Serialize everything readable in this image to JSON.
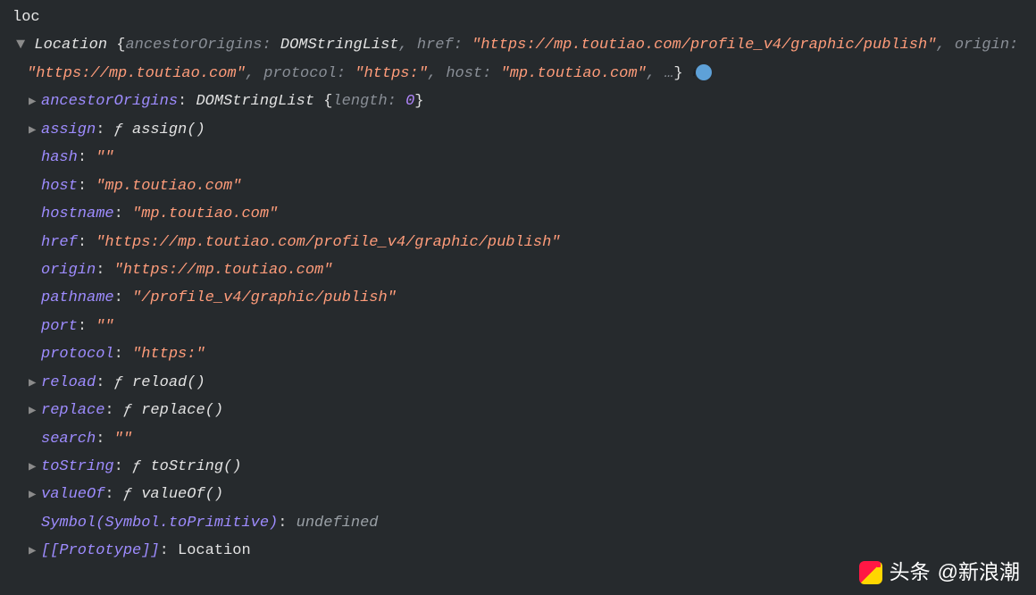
{
  "input": "loc",
  "summary": {
    "typeName": "Location",
    "pairs": [
      {
        "key": "ancestorOrigins",
        "val": "DOMStringList",
        "isStr": false
      },
      {
        "key": "href",
        "val": "\"https://mp.toutiao.com/profile_v4/graphic/publish\"",
        "isStr": true
      },
      {
        "key": "origin",
        "val": "\"https://mp.toutiao.com\"",
        "isStr": true
      },
      {
        "key": "protocol",
        "val": "\"https:\"",
        "isStr": true
      },
      {
        "key": "host",
        "val": "\"mp.toutiao.com\"",
        "isStr": true
      }
    ],
    "ellipsis": "…"
  },
  "props": [
    {
      "expand": true,
      "key": "ancestorOrigins",
      "rhsPrefix": "DOMStringList ",
      "rhsBraceL": "{",
      "innerKey": "length",
      "innerVal": "0",
      "rhsBraceR": "}"
    },
    {
      "expand": true,
      "key": "assign",
      "func": "assign()"
    },
    {
      "expand": false,
      "key": "hash",
      "str": "\"\""
    },
    {
      "expand": false,
      "key": "host",
      "str": "\"mp.toutiao.com\""
    },
    {
      "expand": false,
      "key": "hostname",
      "str": "\"mp.toutiao.com\""
    },
    {
      "expand": false,
      "key": "href",
      "str": "\"https://mp.toutiao.com/profile_v4/graphic/publish\""
    },
    {
      "expand": false,
      "key": "origin",
      "str": "\"https://mp.toutiao.com\""
    },
    {
      "expand": false,
      "key": "pathname",
      "str": "\"/profile_v4/graphic/publish\""
    },
    {
      "expand": false,
      "key": "port",
      "str": "\"\""
    },
    {
      "expand": false,
      "key": "protocol",
      "str": "\"https:\""
    },
    {
      "expand": true,
      "key": "reload",
      "func": "reload()"
    },
    {
      "expand": true,
      "key": "replace",
      "func": "replace()"
    },
    {
      "expand": false,
      "key": "search",
      "str": "\"\""
    },
    {
      "expand": true,
      "key": "toString",
      "func": "toString()"
    },
    {
      "expand": true,
      "key": "valueOf",
      "func": "valueOf()"
    },
    {
      "expand": false,
      "key": "Symbol(Symbol.toPrimitive)",
      "undef": "undefined"
    },
    {
      "expand": true,
      "key": "[[Prototype]]",
      "proto": true,
      "plain": "Location"
    }
  ],
  "watermark": {
    "label": "头条",
    "handle": "@新浪潮"
  }
}
